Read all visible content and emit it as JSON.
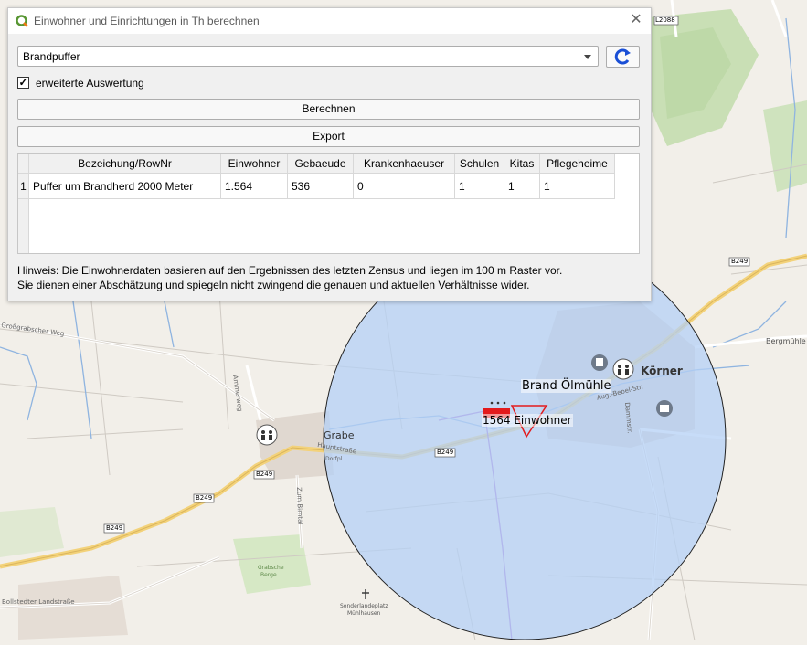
{
  "dialog": {
    "title": "Einwohner und Einrichtungen in Th berechnen",
    "close_icon": "close-icon",
    "combo_value": "Brandpuffer",
    "checkbox_label": "erweiterte Auswertung",
    "checkbox_checked": true,
    "calc_button": "Berechnen",
    "export_button": "Export",
    "table": {
      "headers": [
        "Bezeichung/RowNr",
        "Einwohner",
        "Gebaeude",
        "Krankenhaeuser",
        "Schulen",
        "Kitas",
        "Pflegeheime"
      ],
      "rows": [
        {
          "rownum": "1",
          "bezeichnung": "Puffer um Brandherd 2000 Meter",
          "einwohner": "1.564",
          "gebaeude": "536",
          "krankenhaeuser": "0",
          "schulen": "1",
          "kitas": "1",
          "pflegeheime": "1"
        }
      ]
    },
    "hint_line1": "Hinweis: Die Einwohnerdaten basieren auf den Ergebnissen des letzten Zensus und liegen im 100 m Raster vor.",
    "hint_line2": "Sie dienen einer Abschätzung und spiegeln nicht zwingend die genauen und aktuellen Verhältnisse wider."
  },
  "map": {
    "fire_label": "Brand Ölmühle",
    "inhabitants_label": "1564 Einwohner",
    "town_korner": "Körner",
    "village_grabe": "Grabe",
    "place_bergmuehle": "Bergmühle",
    "road_b249": "B249",
    "road_l2088": "L2088",
    "street_grossgrabscher": "Großgrabscher Weg",
    "street_bollstedter": "Bollstedter Landstraße",
    "street_ammerweg": "Ammerweg",
    "street_zum_birntal": "Zum Birntal",
    "street_hauptstrasse": "Hauptstraße",
    "street_dorfpl": "Dorfpl.",
    "street_damm": "Dammstr.",
    "street_aug_bebel": "Aug.-Bebel-Str.",
    "cemetery_line1": "Sonderlandeplatz",
    "cemetery_line2": "Mühlhausen",
    "grabsche_line1": "Grabsche",
    "grabsche_line2": "Berge",
    "buffer_color": "#b4d0f5",
    "fire_color": "#e31a1c"
  }
}
